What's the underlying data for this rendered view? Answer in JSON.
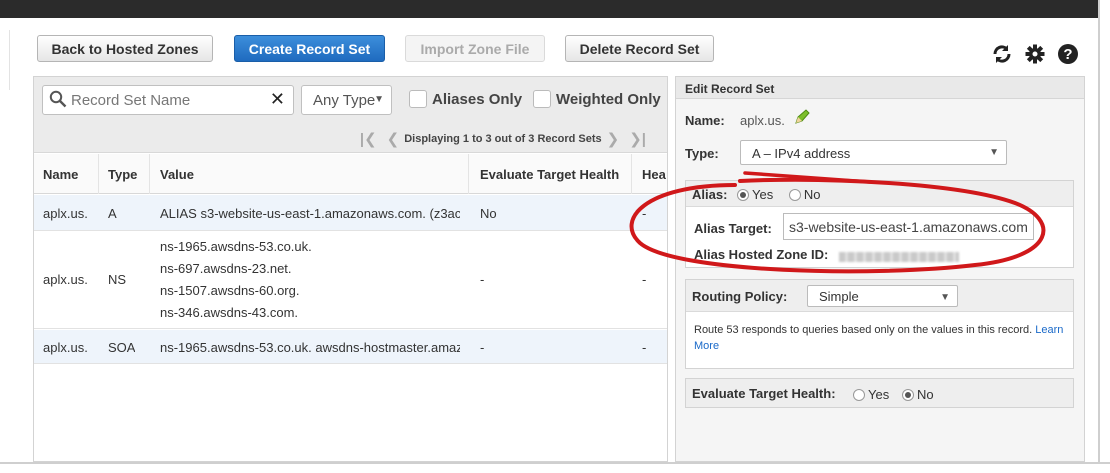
{
  "toolbar": {
    "back_label": "Back to Hosted Zones",
    "create_label": "Create Record Set",
    "import_label": "Import Zone File",
    "delete_label": "Delete Record Set",
    "icons": [
      "refresh-icon",
      "gear-icon",
      "help-icon"
    ]
  },
  "filter": {
    "search_placeholder": "Record Set Name",
    "type_select": "Any Type",
    "aliases_only": "Aliases Only",
    "weighted_only": "Weighted Only",
    "pager_text": "Displaying 1 to 3 out of 3 Record Sets"
  },
  "table": {
    "columns": [
      "Name",
      "Type",
      "Value",
      "Evaluate Target Health",
      "Hea"
    ],
    "rows": [
      {
        "name": "aplx.us.",
        "type": "A",
        "value": "ALIAS s3-website-us-east-1.amazonaws.com. (z3ac",
        "eval": "No",
        "health": "-"
      },
      {
        "name": "aplx.us.",
        "type": "NS",
        "value_lines": [
          "ns-1965.awsdns-53.co.uk.",
          "ns-697.awsdns-23.net.",
          "ns-1507.awsdns-60.org.",
          "ns-346.awsdns-43.com."
        ],
        "eval": "-",
        "health": "-"
      },
      {
        "name": "aplx.us.",
        "type": "SOA",
        "value": "ns-1965.awsdns-53.co.uk. awsdns-hostmaster.amaz",
        "eval": "-",
        "health": "-"
      }
    ]
  },
  "editor": {
    "title": "Edit Record Set",
    "name_label": "Name:",
    "name_value": "aplx.us.",
    "type_label": "Type:",
    "type_value": "A – IPv4 address",
    "alias_label": "Alias:",
    "alias_yes": "Yes",
    "alias_no": "No",
    "alias_target_label": "Alias Target:",
    "alias_target_value": "s3-website-us-east-1.amazonaws.com",
    "alias_zone_label": "Alias Hosted Zone ID:",
    "routing_label": "Routing Policy:",
    "routing_value": "Simple",
    "routing_desc": "Route 53 responds to queries based only on the values in this record.",
    "learn_more": "Learn More",
    "eval_label": "Evaluate Target Health:",
    "eval_yes": "Yes",
    "eval_no": "No"
  },
  "colors": {
    "primary": "#2a7ad0",
    "annotation": "#d0181a"
  }
}
